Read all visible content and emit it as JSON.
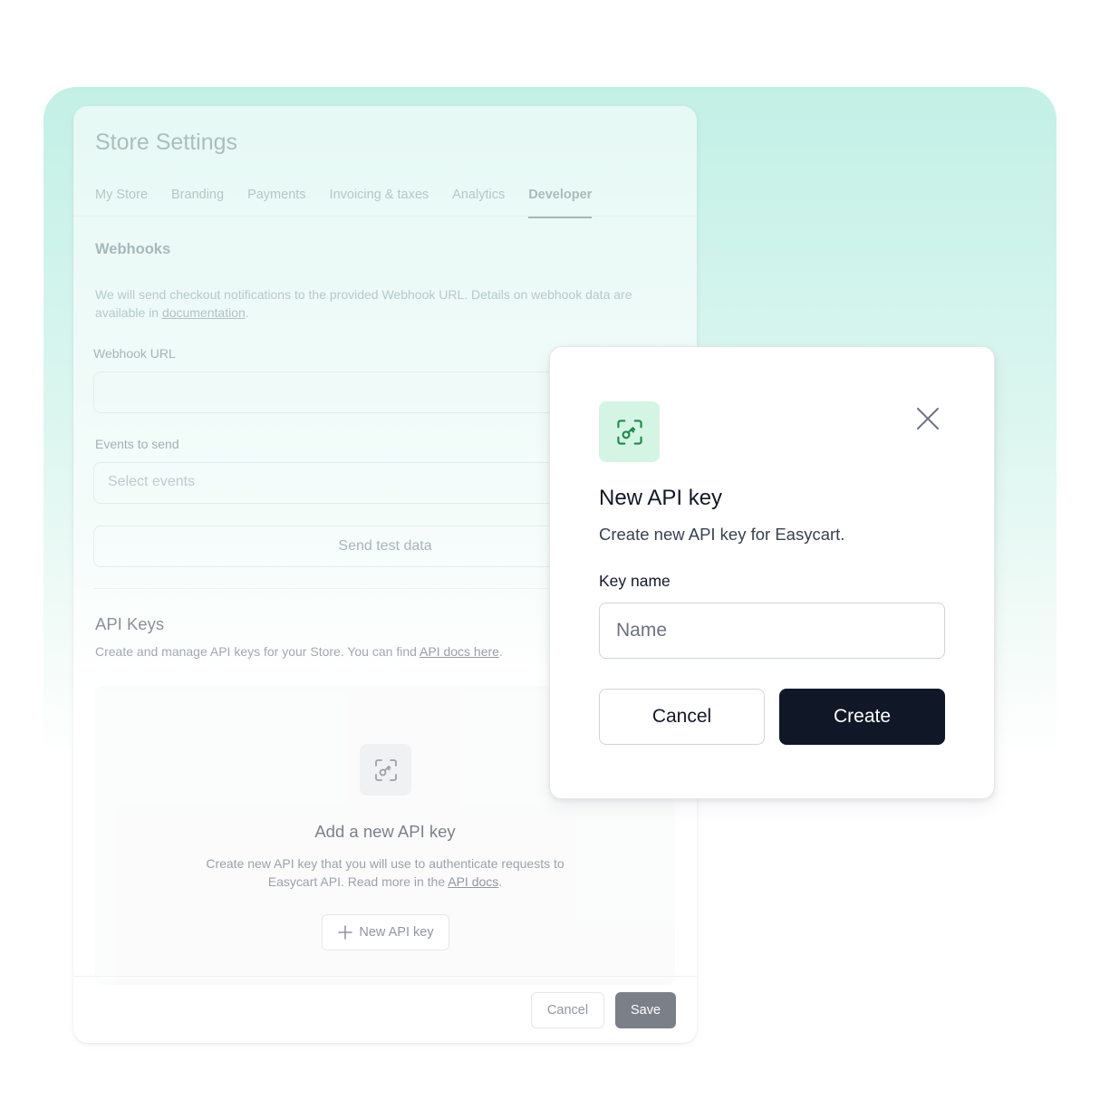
{
  "settings": {
    "title": "Store Settings",
    "tabs": [
      {
        "label": "My Store"
      },
      {
        "label": "Branding"
      },
      {
        "label": "Payments"
      },
      {
        "label": "Invoicing & taxes"
      },
      {
        "label": "Analytics"
      },
      {
        "label": "Developer",
        "active": true
      }
    ],
    "webhooks": {
      "title": "Webhooks",
      "desc_prefix": "We will send checkout notifications to the provided Webhook URL. Details on webhook data are available in ",
      "desc_link": "documentation",
      "desc_suffix": ".",
      "url_label": "Webhook URL",
      "url_value": "",
      "events_label": "Events to send",
      "events_placeholder": "Select events",
      "test_button": "Send test data"
    },
    "api_keys": {
      "title": "API Keys",
      "desc_prefix": "Create and manage API keys for your Store. You can find ",
      "desc_link": "API docs here",
      "desc_suffix": ".",
      "empty_title": "Add a new API key",
      "empty_desc_prefix": "Create new API key that you will use to authenticate requests to Easycart API. Read more in the ",
      "empty_desc_link": "API docs",
      "empty_desc_suffix": ".",
      "new_key_button": "New API key",
      "icon": "key-scan-icon"
    },
    "footer": {
      "cancel_label": "Cancel",
      "save_label": "Save"
    }
  },
  "modal": {
    "icon": "key-scan-icon",
    "close_icon": "close-icon",
    "title": "New API key",
    "subtitle": "Create new API key for Easycart.",
    "field_label": "Key name",
    "field_placeholder": "Name",
    "field_value": "",
    "cancel_label": "Cancel",
    "create_label": "Create"
  },
  "colors": {
    "accent_green": "#1f8a4c",
    "icon_bg_green": "#d4f5e4",
    "primary_dark": "#101827",
    "backdrop_mint": "#c3f0e6"
  }
}
